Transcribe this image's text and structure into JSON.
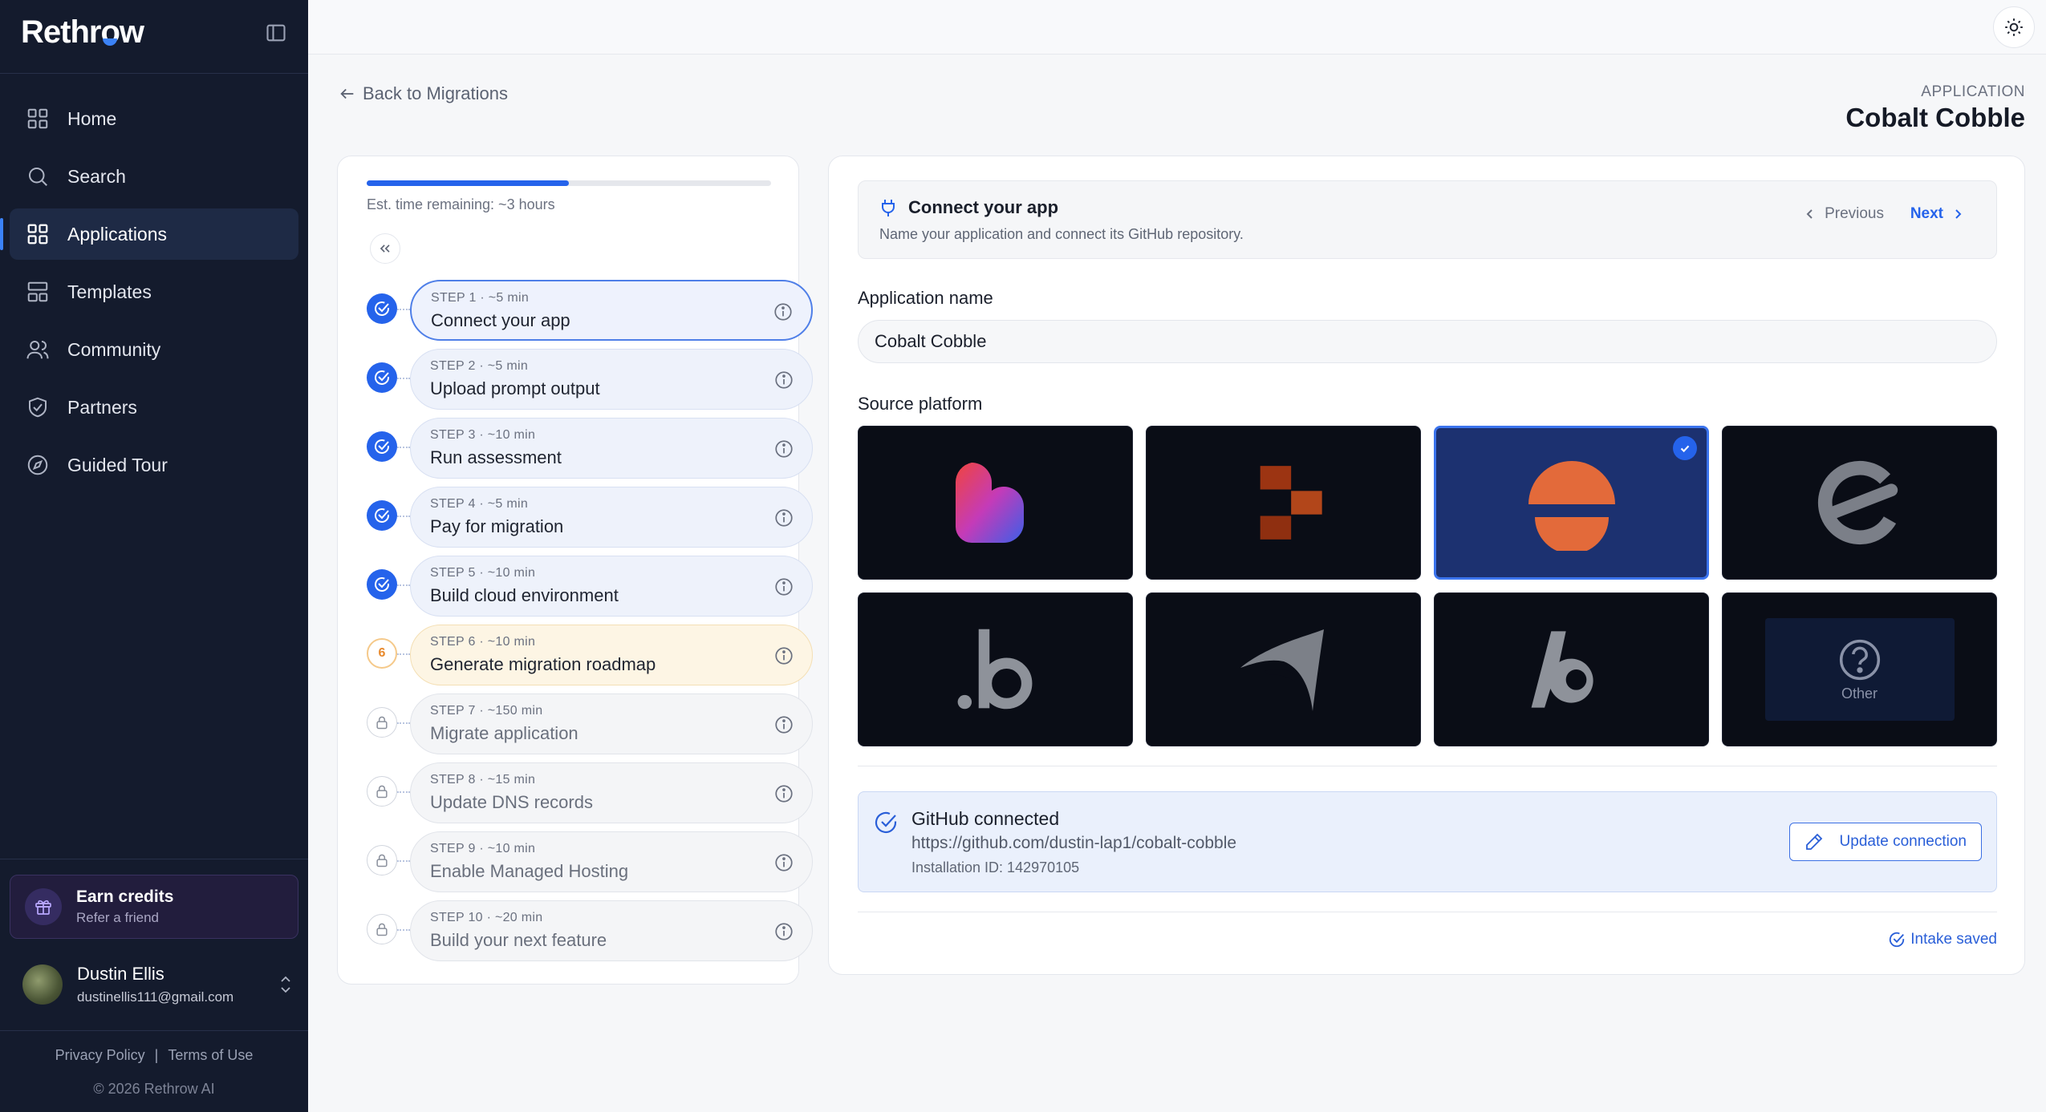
{
  "app": {
    "brand": "Rethrow",
    "colors": {
      "sidebar_bg": "#141b2d",
      "accent": "#2563eb",
      "current_step": "#e8892c"
    }
  },
  "sidebar": {
    "items": [
      {
        "label": "Home",
        "icon": "home-grid-icon",
        "active": false
      },
      {
        "label": "Search",
        "icon": "search-icon",
        "active": false
      },
      {
        "label": "Applications",
        "icon": "applications-grid-icon",
        "active": true
      },
      {
        "label": "Templates",
        "icon": "templates-icon",
        "active": false
      },
      {
        "label": "Community",
        "icon": "users-icon",
        "active": false
      },
      {
        "label": "Partners",
        "icon": "handshake-shield-icon",
        "active": false
      },
      {
        "label": "Guided Tour",
        "icon": "compass-icon",
        "active": false
      }
    ],
    "earn": {
      "title": "Earn credits",
      "subtitle": "Refer a friend"
    },
    "user": {
      "name": "Dustin Ellis",
      "email": "dustinellis111@gmail.com"
    },
    "legal": {
      "privacy": "Privacy Policy",
      "separator": "|",
      "terms": "Terms of Use",
      "copyright": "© 2026 Rethrow AI"
    }
  },
  "header": {
    "back_label": "Back to Migrations",
    "app_label": "APPLICATION",
    "app_title": "Cobalt Cobble"
  },
  "steps": {
    "progress_percent": 50,
    "estimate": "Est. time remaining: ~3 hours",
    "items": [
      {
        "meta": "STEP 1 · ~5 min",
        "title": "Connect your app",
        "status": "done",
        "selected": true
      },
      {
        "meta": "STEP 2 · ~5 min",
        "title": "Upload prompt output",
        "status": "done",
        "selected": false
      },
      {
        "meta": "STEP 3 · ~10 min",
        "title": "Run assessment",
        "status": "done",
        "selected": false
      },
      {
        "meta": "STEP 4 · ~5 min",
        "title": "Pay for migration",
        "status": "done",
        "selected": false
      },
      {
        "meta": "STEP 5 · ~10 min",
        "title": "Build cloud environment",
        "status": "done",
        "selected": false
      },
      {
        "meta": "STEP 6 · ~10 min",
        "title": "Generate migration roadmap",
        "status": "current",
        "badge": "6",
        "selected": false
      },
      {
        "meta": "STEP 7 · ~150 min",
        "title": "Migrate application",
        "status": "locked",
        "selected": false
      },
      {
        "meta": "STEP 8 · ~15 min",
        "title": "Update DNS records",
        "status": "locked",
        "selected": false
      },
      {
        "meta": "STEP 9 · ~10 min",
        "title": "Enable Managed Hosting",
        "status": "locked",
        "selected": false
      },
      {
        "meta": "STEP 10 · ~20 min",
        "title": "Build your next feature",
        "status": "locked",
        "selected": false
      }
    ]
  },
  "main": {
    "section_title": "Connect your app",
    "section_subtitle": "Name your application and connect its GitHub repository.",
    "prev_label": "Previous",
    "next_label": "Next",
    "app_name_label": "Application name",
    "app_name_value": "Cobalt Cobble",
    "source_label": "Source platform",
    "platforms": [
      {
        "icon": "lovable-heart-logo-icon",
        "selected": false
      },
      {
        "icon": "orange-blocks-logo-icon",
        "selected": false
      },
      {
        "icon": "orange-sun-logo-icon",
        "selected": true
      },
      {
        "icon": "grey-e-logo-icon",
        "selected": false
      },
      {
        "icon": "dot-b-logo-icon",
        "selected": false
      },
      {
        "icon": "grey-swoosh-logo-icon",
        "selected": false
      },
      {
        "icon": "italic-b-logo-icon",
        "selected": false
      },
      {
        "icon": "question-mark-icon",
        "label": "Other",
        "selected": false
      }
    ],
    "github": {
      "title": "GitHub connected",
      "url": "https://github.com/dustin-lap1/cobalt-cobble",
      "installation": "Installation ID: 142970105",
      "update_label": "Update connection"
    },
    "saved_label": "Intake saved"
  }
}
